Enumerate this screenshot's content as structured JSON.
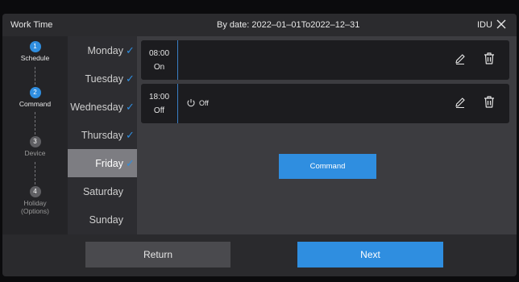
{
  "header": {
    "title": "Work Time",
    "date_range": "By date: 2022–01–01To2022–12–31",
    "idu_label": "IDU",
    "close_icon": "close-icon"
  },
  "steps": [
    {
      "number": "1",
      "label": "Schedule",
      "active": true
    },
    {
      "number": "2",
      "label": "Command",
      "active": true
    },
    {
      "number": "3",
      "label": "Device",
      "active": false
    },
    {
      "number": "4",
      "label": "Holiday\n(Options)",
      "active": false
    }
  ],
  "days": [
    {
      "label": "Monday",
      "checked": true,
      "selected": false
    },
    {
      "label": "Tuesday",
      "checked": true,
      "selected": false
    },
    {
      "label": "Wednesday",
      "checked": true,
      "selected": false
    },
    {
      "label": "Thursday",
      "checked": true,
      "selected": false
    },
    {
      "label": "Friday",
      "checked": true,
      "selected": true
    },
    {
      "label": "Saturday",
      "checked": false,
      "selected": false
    },
    {
      "label": "Sunday",
      "checked": false,
      "selected": false
    }
  ],
  "schedule_rows": [
    {
      "time": "08:00",
      "state": "On",
      "action": ""
    },
    {
      "time": "18:00",
      "state": "Off",
      "action": "Off"
    }
  ],
  "command_button": "Command",
  "footer": {
    "return_label": "Return",
    "next_label": "Next"
  },
  "colors": {
    "accent": "#2f8ee0",
    "background": "#1b1b1d",
    "content_panel": "#3c3c40",
    "selected_day": "#7d7d82"
  }
}
